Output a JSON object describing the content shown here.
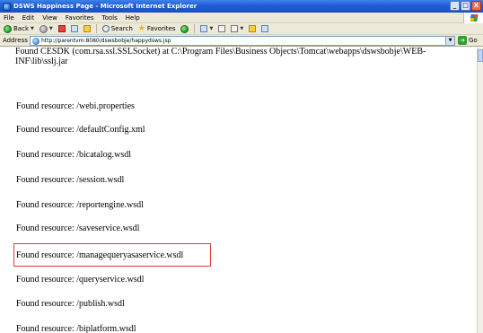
{
  "window": {
    "title": "DSWS Happiness Page - Microsoft Internet Explorer",
    "minimize_label": "_",
    "close_label": "X"
  },
  "menu": {
    "items": [
      "File",
      "Edit",
      "View",
      "Favorites",
      "Tools",
      "Help"
    ]
  },
  "toolbar": {
    "back_label": "Back",
    "search_label": "Search",
    "favorites_label": "Favorites"
  },
  "address": {
    "label": "Address",
    "url": "http://parentvm:8080/dswsbobje/happydsws.jsp",
    "go_label": "Go"
  },
  "content": {
    "cesdk_text": "Found CESDK (com.rsa.ssl.SSLSocket) at C:\\Program Files\\Business Objects\\Tomcat\\webapps\\dswsbobje\\WEB-INF\\lib\\sslj.jar",
    "resources": [
      "Found resource: /webi.properties",
      "Found resource: /defaultConfig.xml",
      "Found resource: /bicatalog.wsdl",
      "Found resource: /session.wsdl",
      "Found resource: /reportengine.wsdl",
      "Found resource: /saveservice.wsdl",
      "Found resource: /managequeryasaservice.wsdl",
      "Found resource: /queryservice.wsdl",
      "Found resource: /publish.wsdl",
      "Found resource: /biplatform.wsdl"
    ],
    "highlight_color": "#e03a3a"
  },
  "colors": {
    "titlebar": "#1f5bd6",
    "chrome": "#ece9d8"
  }
}
